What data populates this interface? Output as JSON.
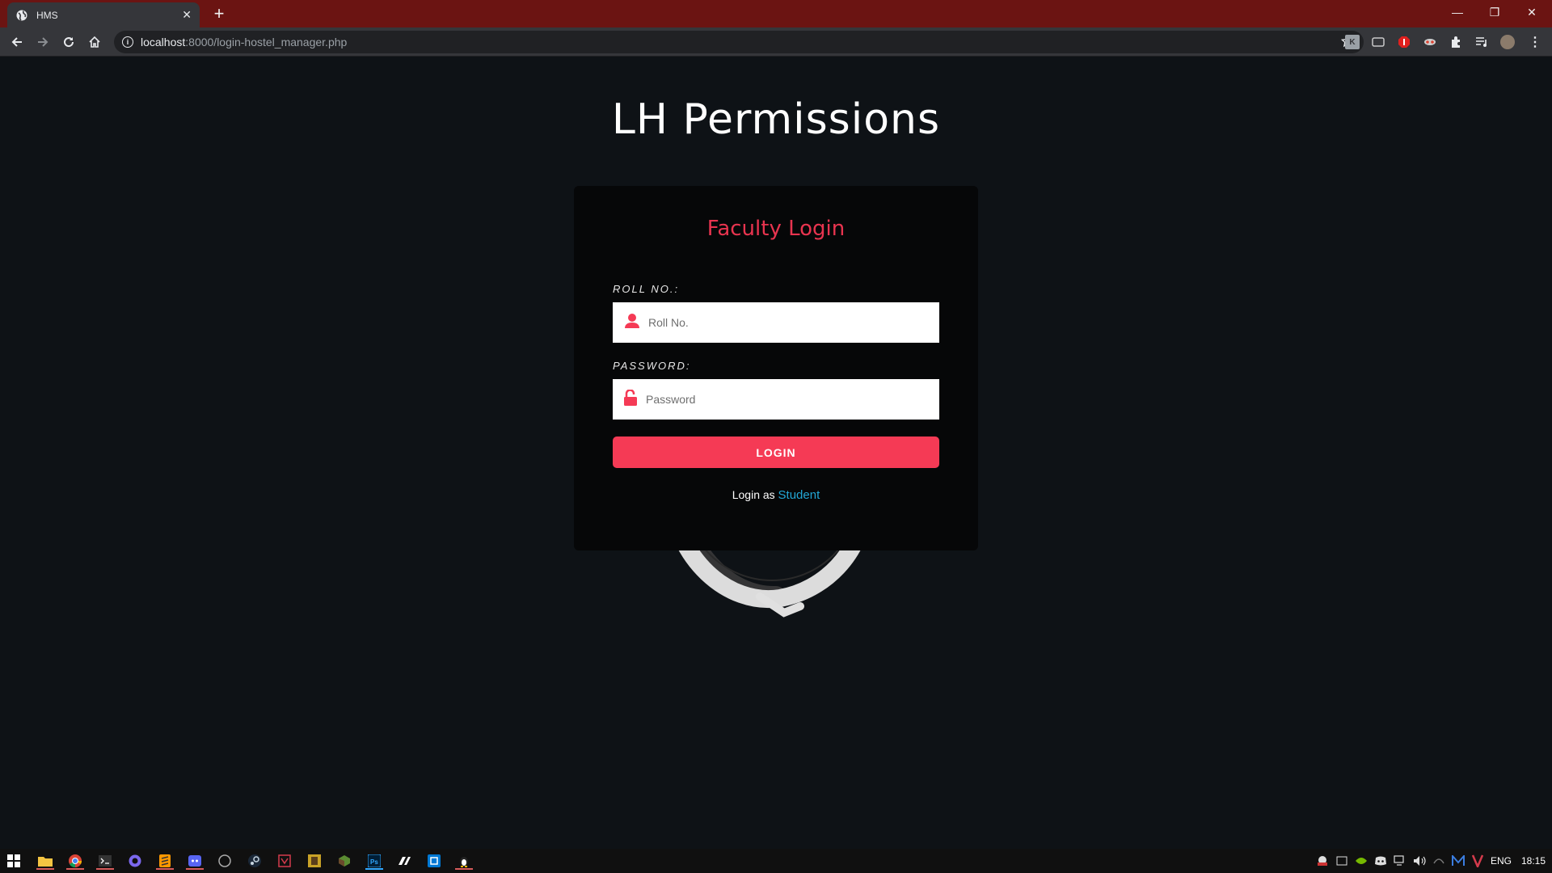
{
  "browser": {
    "tab_title": "HMS",
    "url_host": "localhost",
    "url_path": ":8000/login-hostel_manager.php",
    "tab_close": "✕",
    "new_tab": "+",
    "minimize": "—",
    "restore": "❐",
    "close": "✕"
  },
  "page": {
    "title": "LH Permissions"
  },
  "login_card": {
    "heading": "Faculty Login",
    "roll_label": "ROLL NO.:",
    "roll_placeholder": "Roll No.",
    "password_label": "PASSWORD:",
    "password_placeholder": "Password",
    "login_button": "LOGIN",
    "switch_prefix": "Login as",
    "switch_link": "Student"
  },
  "taskbar": {
    "language": "ENG",
    "time": "18:15"
  },
  "colors": {
    "accent": "#f53a55",
    "link": "#23a6d5",
    "background": "#0e1216",
    "card": "#060708",
    "tabbar": "#6b1412"
  }
}
